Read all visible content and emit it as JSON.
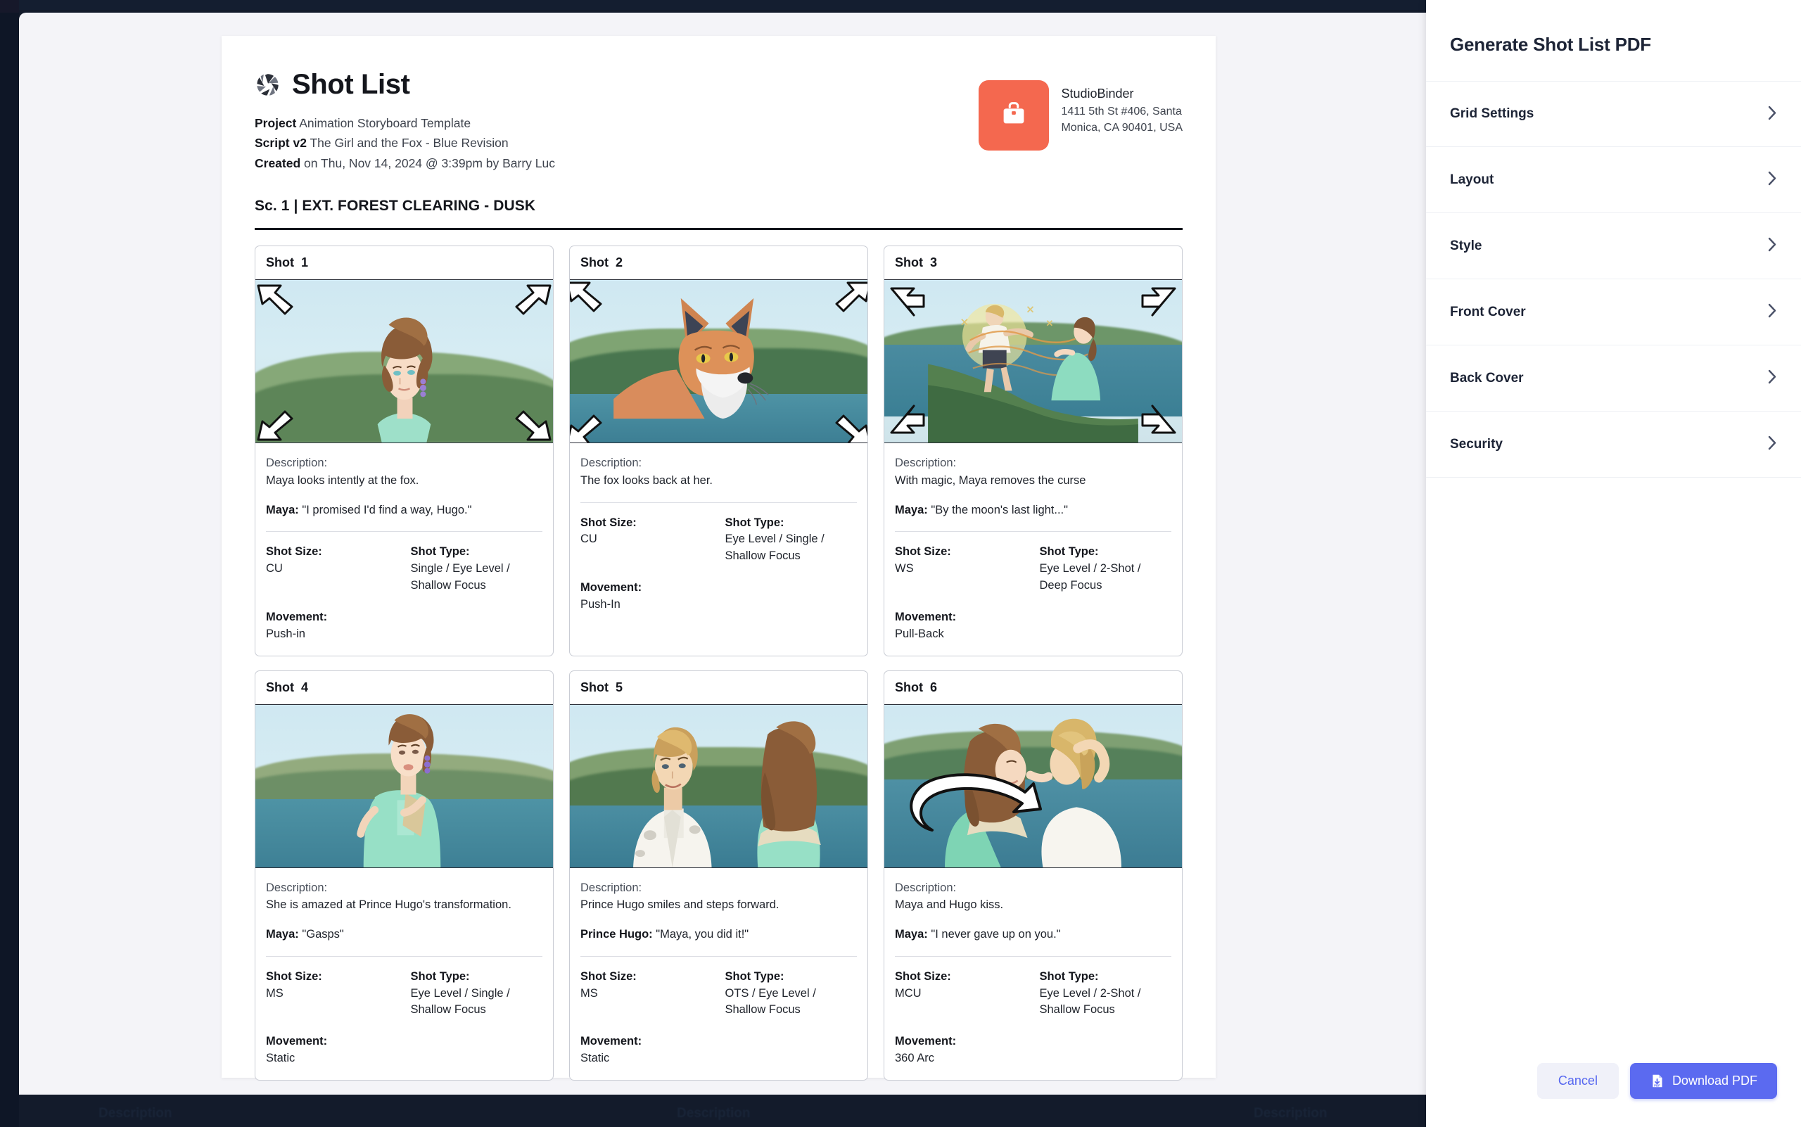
{
  "document": {
    "logo_icon": "aperture-icon",
    "title": "Shot List",
    "meta": [
      {
        "key": "Project",
        "value": "Animation Storyboard Template"
      },
      {
        "key": "Script v2",
        "value": "The Girl and the Fox - Blue Revision"
      },
      {
        "key": "Created",
        "value": "on Thu, Nov 14, 2024 @ 3:39pm by Barry Luc"
      }
    ],
    "company": {
      "logo_icon": "briefcase-icon",
      "logo_color": "#f4684f",
      "name": "StudioBinder",
      "address_line1": "1411 5th St #406, Santa",
      "address_line2": "Monica, CA 90401, USA"
    },
    "scene_heading": "Sc. 1 | EXT. FOREST CLEARING - DUSK",
    "field_labels": {
      "description": "Description:",
      "shot_size": "Shot Size:",
      "shot_type": "Shot Type:",
      "movement": "Movement:"
    },
    "shot_word": "Shot",
    "shots": [
      {
        "number": "1",
        "description": "Maya looks intently at the fox.",
        "speaker": "Maya:",
        "dialogue": "\"I promised I'd find a way, Hugo.\"",
        "shot_size": "CU",
        "shot_type": "Single / Eye Level / Shallow Focus",
        "movement": "Push-in",
        "art": "maya-closeup-push-in"
      },
      {
        "number": "2",
        "description": "The fox looks back at her.",
        "speaker": "",
        "dialogue": "",
        "shot_size": "CU",
        "shot_type": "Eye Level / Single / Shallow Focus",
        "movement": "Push-In",
        "art": "fox-closeup-push-in"
      },
      {
        "number": "3",
        "description": "With magic, Maya removes the curse",
        "speaker": "Maya:",
        "dialogue": "\"By the moon's last light...\"",
        "shot_size": "WS",
        "shot_type": "Eye Level / 2-Shot / Deep Focus",
        "movement": "Pull-Back",
        "art": "transformation-wide-pull-back"
      },
      {
        "number": "4",
        "description": "She is amazed at Prince Hugo's transformation.",
        "speaker": "Maya:",
        "dialogue": "\"Gasps\"",
        "shot_size": "MS",
        "shot_type": "Eye Level / Single / Shallow Focus",
        "movement": "Static",
        "art": "maya-amazed-static"
      },
      {
        "number": "5",
        "description": "Prince Hugo smiles and steps forward.",
        "speaker": "Prince Hugo:",
        "dialogue": "\"Maya, you did it!\"",
        "shot_size": "MS",
        "shot_type": "OTS / Eye Level / Shallow Focus",
        "movement": "Static",
        "art": "hugo-ots-static"
      },
      {
        "number": "6",
        "description": "Maya and Hugo kiss.",
        "speaker": "Maya:",
        "dialogue": "\"I never gave up on you.\"",
        "shot_size": "MCU",
        "shot_type": "Eye Level / 2-Shot / Shallow Focus",
        "movement": "360 Arc",
        "art": "kiss-360-arc"
      }
    ]
  },
  "settings_panel": {
    "title": "Generate Shot List PDF",
    "rows": [
      {
        "label": "Grid Settings",
        "icon": "chevron-right-icon"
      },
      {
        "label": "Layout",
        "icon": "chevron-right-icon"
      },
      {
        "label": "Style",
        "icon": "chevron-right-icon"
      },
      {
        "label": "Front Cover",
        "icon": "chevron-right-icon"
      },
      {
        "label": "Back Cover",
        "icon": "chevron-right-icon"
      },
      {
        "label": "Security",
        "icon": "chevron-right-icon"
      }
    ],
    "cancel_label": "Cancel",
    "download_label": "Download PDF",
    "download_icon": "pdf-download-icon",
    "accent_color": "#5b6af0"
  },
  "backdrop": {
    "ghost_labels": [
      "Description",
      "Description",
      "Description"
    ],
    "avatar_icon": "user-avatar-dot"
  }
}
